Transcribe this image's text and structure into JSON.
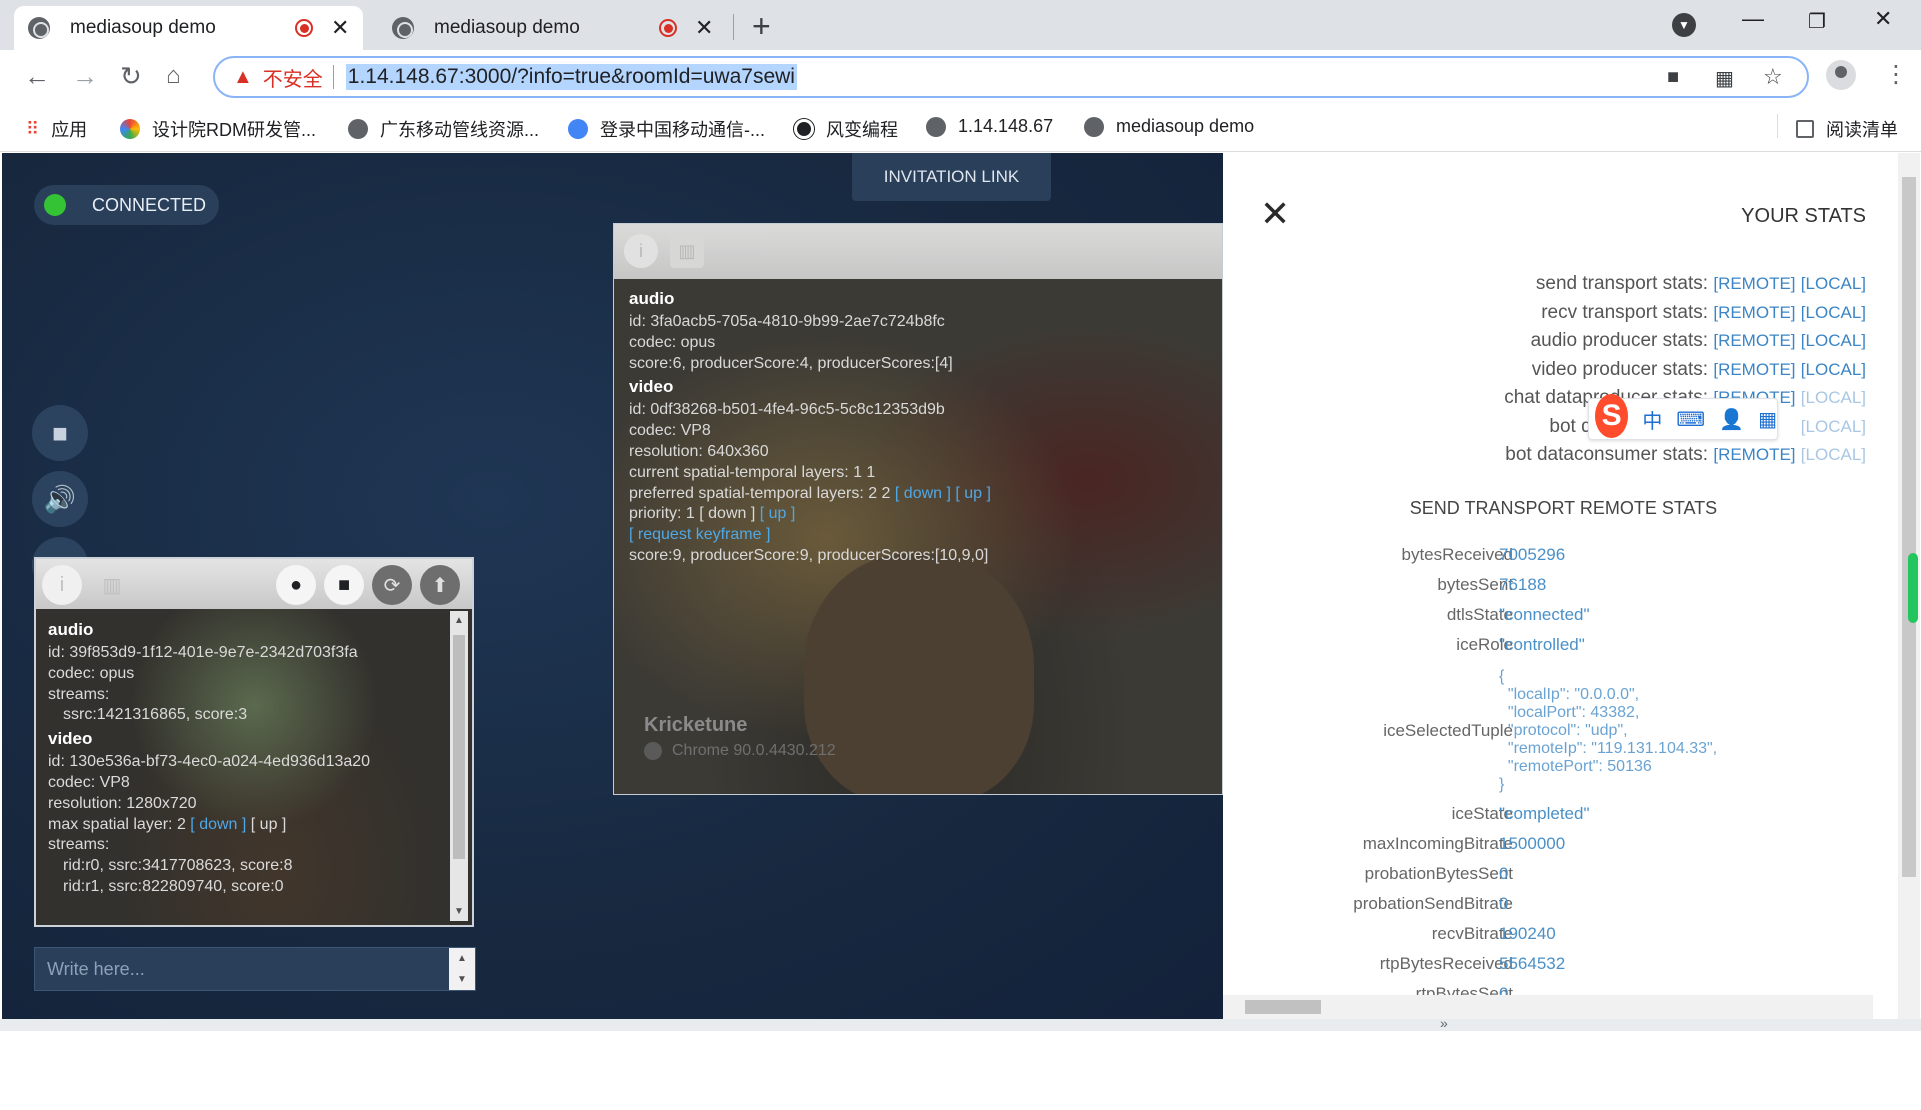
{
  "browser": {
    "tabs": [
      {
        "title": "mediasoup demo",
        "active": true
      },
      {
        "title": "mediasoup demo",
        "active": false
      }
    ],
    "new_tab": "+",
    "security_label": "不安全",
    "url": "1.14.148.67:3000/?info=true&roomId=uwa7sewi",
    "bookmarks": [
      {
        "label": "应用",
        "icon": "apps-grid-icon"
      },
      {
        "label": "设计院RDM研发管...",
        "icon": "colorful-logo-icon"
      },
      {
        "label": "广东移动管线资源...",
        "icon": "globe-icon"
      },
      {
        "label": "登录中国移动通信-...",
        "icon": "china-mobile-icon"
      },
      {
        "label": "风变编程",
        "icon": "panda-icon"
      },
      {
        "label": "1.14.148.67",
        "icon": "globe-icon"
      },
      {
        "label": "mediasoup demo",
        "icon": "globe-icon"
      }
    ],
    "reading_list": "阅读清单"
  },
  "room": {
    "status": "CONNECTED",
    "invitation": "INVITATION LINK",
    "chat_placeholder": "Write here..."
  },
  "peer": {
    "name": "Kricketune",
    "device": "Chrome 90.0.4430.212",
    "audio_heading": "audio",
    "audio_id": "id: 3fa0acb5-705a-4810-9b99-2ae7c724b8fc",
    "audio_codec": "codec: opus",
    "audio_score": "score:6, producerScore:4, producerScores:[4]",
    "video_heading": "video",
    "video_id": "id: 0df38268-b501-4fe4-96c5-5c8c12353d9b",
    "video_codec": "codec: VP8",
    "video_resolution": "resolution: 640x360",
    "current_layers": "current spatial-temporal layers: 1 1",
    "preferred_layers": "preferred spatial-temporal layers: 2 2",
    "priority": "priority: 1",
    "down": "[ down ]",
    "up": "[ up ]",
    "request_keyframe": "[ request keyframe ]",
    "video_score": "score:9, producerScore:9, producerScores:[10,9,0]"
  },
  "me": {
    "audio_heading": "audio",
    "audio_id": "id: 39f853d9-1f12-401e-9e7e-2342d703f3fa",
    "audio_codec": "codec: opus",
    "streams_label": "streams:",
    "audio_stream": "ssrc:1421316865, score:3",
    "video_heading": "video",
    "video_id": "id: 130e536a-bf73-4ec0-a024-4ed936d13a20",
    "video_codec": "codec: VP8",
    "video_resolution": "resolution: 1280x720",
    "max_spatial": "max spatial layer: 2",
    "down": "[ down ]",
    "up": "[ up ]",
    "stream_r0": "rid:r0, ssrc:3417708623, score:8",
    "stream_r1": "rid:r1, ssrc:822809740, score:0"
  },
  "stats": {
    "title": "YOUR STATS",
    "remote": "[REMOTE]",
    "local": "[LOCAL]",
    "links": [
      "send transport stats:",
      "recv transport stats:",
      "audio producer stats:",
      "video producer stats:",
      "chat dataproducer stats:",
      "bot datapro",
      "bot dataconsumer stats:"
    ],
    "section": "SEND TRANSPORT REMOTE STATS",
    "rows": [
      {
        "k": "bytesReceived",
        "v": "7005296"
      },
      {
        "k": "bytesSent",
        "v": "76188"
      },
      {
        "k": "dtlsState",
        "v": "\"connected\""
      },
      {
        "k": "iceRole",
        "v": "\"controlled\""
      },
      {
        "k": "iceSelectedTuple",
        "v": "{\n  \"localIp\": \"0.0.0.0\",\n  \"localPort\": 43382,\n  \"protocol\": \"udp\",\n  \"remoteIp\": \"119.131.104.33\",\n  \"remotePort\": 50136\n}"
      },
      {
        "k": "iceState",
        "v": "\"completed\""
      },
      {
        "k": "maxIncomingBitrate",
        "v": "1500000"
      },
      {
        "k": "probationBytesSent",
        "v": "0"
      },
      {
        "k": "probationSendBitrate",
        "v": "0"
      },
      {
        "k": "recvBitrate",
        "v": "190240"
      },
      {
        "k": "rtpBytesReceived",
        "v": "5564532"
      },
      {
        "k": "rtpBytesSent",
        "v": "0"
      }
    ]
  },
  "ime": {
    "chars": [
      "中",
      "⌨",
      "👤",
      "▦"
    ],
    "logo": "S"
  },
  "colors": {
    "page_bg": "#17283f",
    "connected_dot": "#34c334",
    "link_blue": "#3b85c6"
  }
}
